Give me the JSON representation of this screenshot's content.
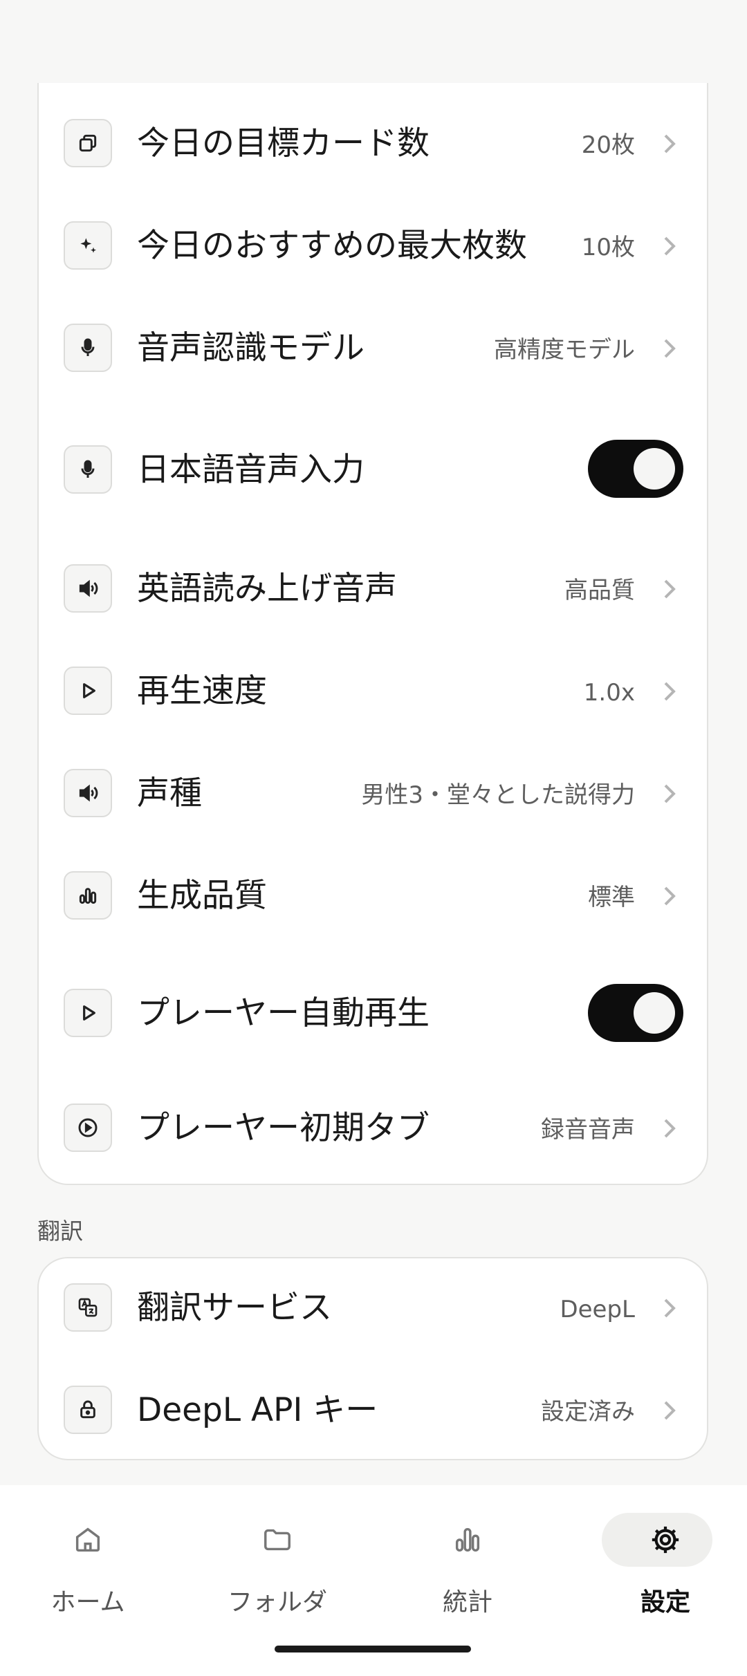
{
  "settings": {
    "rows": [
      {
        "label": "今日の目標カード数",
        "value": "20枚",
        "icon": "cards-icon"
      },
      {
        "label": "今日のおすすめの最大枚数",
        "value": "10枚",
        "icon": "sparkle-icon"
      },
      {
        "label": "音声認識モデル",
        "value": "高精度モデル",
        "icon": "microphone-icon"
      },
      {
        "label": "日本語音声入力",
        "toggle": true,
        "icon": "microphone-icon"
      },
      {
        "label": "英語読み上げ音声",
        "value": "高品質",
        "icon": "speaker-icon"
      },
      {
        "label": "再生速度",
        "value": "1.0x",
        "icon": "play-icon"
      },
      {
        "label": "声種",
        "value": "男性3・堂々とした説得力",
        "icon": "speaker-icon"
      },
      {
        "label": "生成品質",
        "value": "標準",
        "icon": "bar-chart-icon"
      },
      {
        "label": "プレーヤー自動再生",
        "toggle": true,
        "icon": "play-icon"
      },
      {
        "label": "プレーヤー初期タブ",
        "value": "録音音声",
        "icon": "play-circle-icon"
      }
    ]
  },
  "translation": {
    "section_title": "翻訳",
    "rows": [
      {
        "label": "翻訳サービス",
        "value": "DeepL",
        "icon": "translate-icon"
      },
      {
        "label": "DeepL API キー",
        "value": "設定済み",
        "icon": "lock-icon"
      }
    ]
  },
  "nav": {
    "items": [
      {
        "label": "ホーム",
        "icon": "home-icon",
        "active": false
      },
      {
        "label": "フォルダ",
        "icon": "folder-icon",
        "active": false
      },
      {
        "label": "統計",
        "icon": "stats-icon",
        "active": false
      },
      {
        "label": "設定",
        "icon": "gear-icon",
        "active": true
      }
    ]
  },
  "colors": {
    "background": "#f7f7f6",
    "card": "#ffffff",
    "toggle_on": "#0d0d0d",
    "active_nav_pill": "#efefed"
  }
}
